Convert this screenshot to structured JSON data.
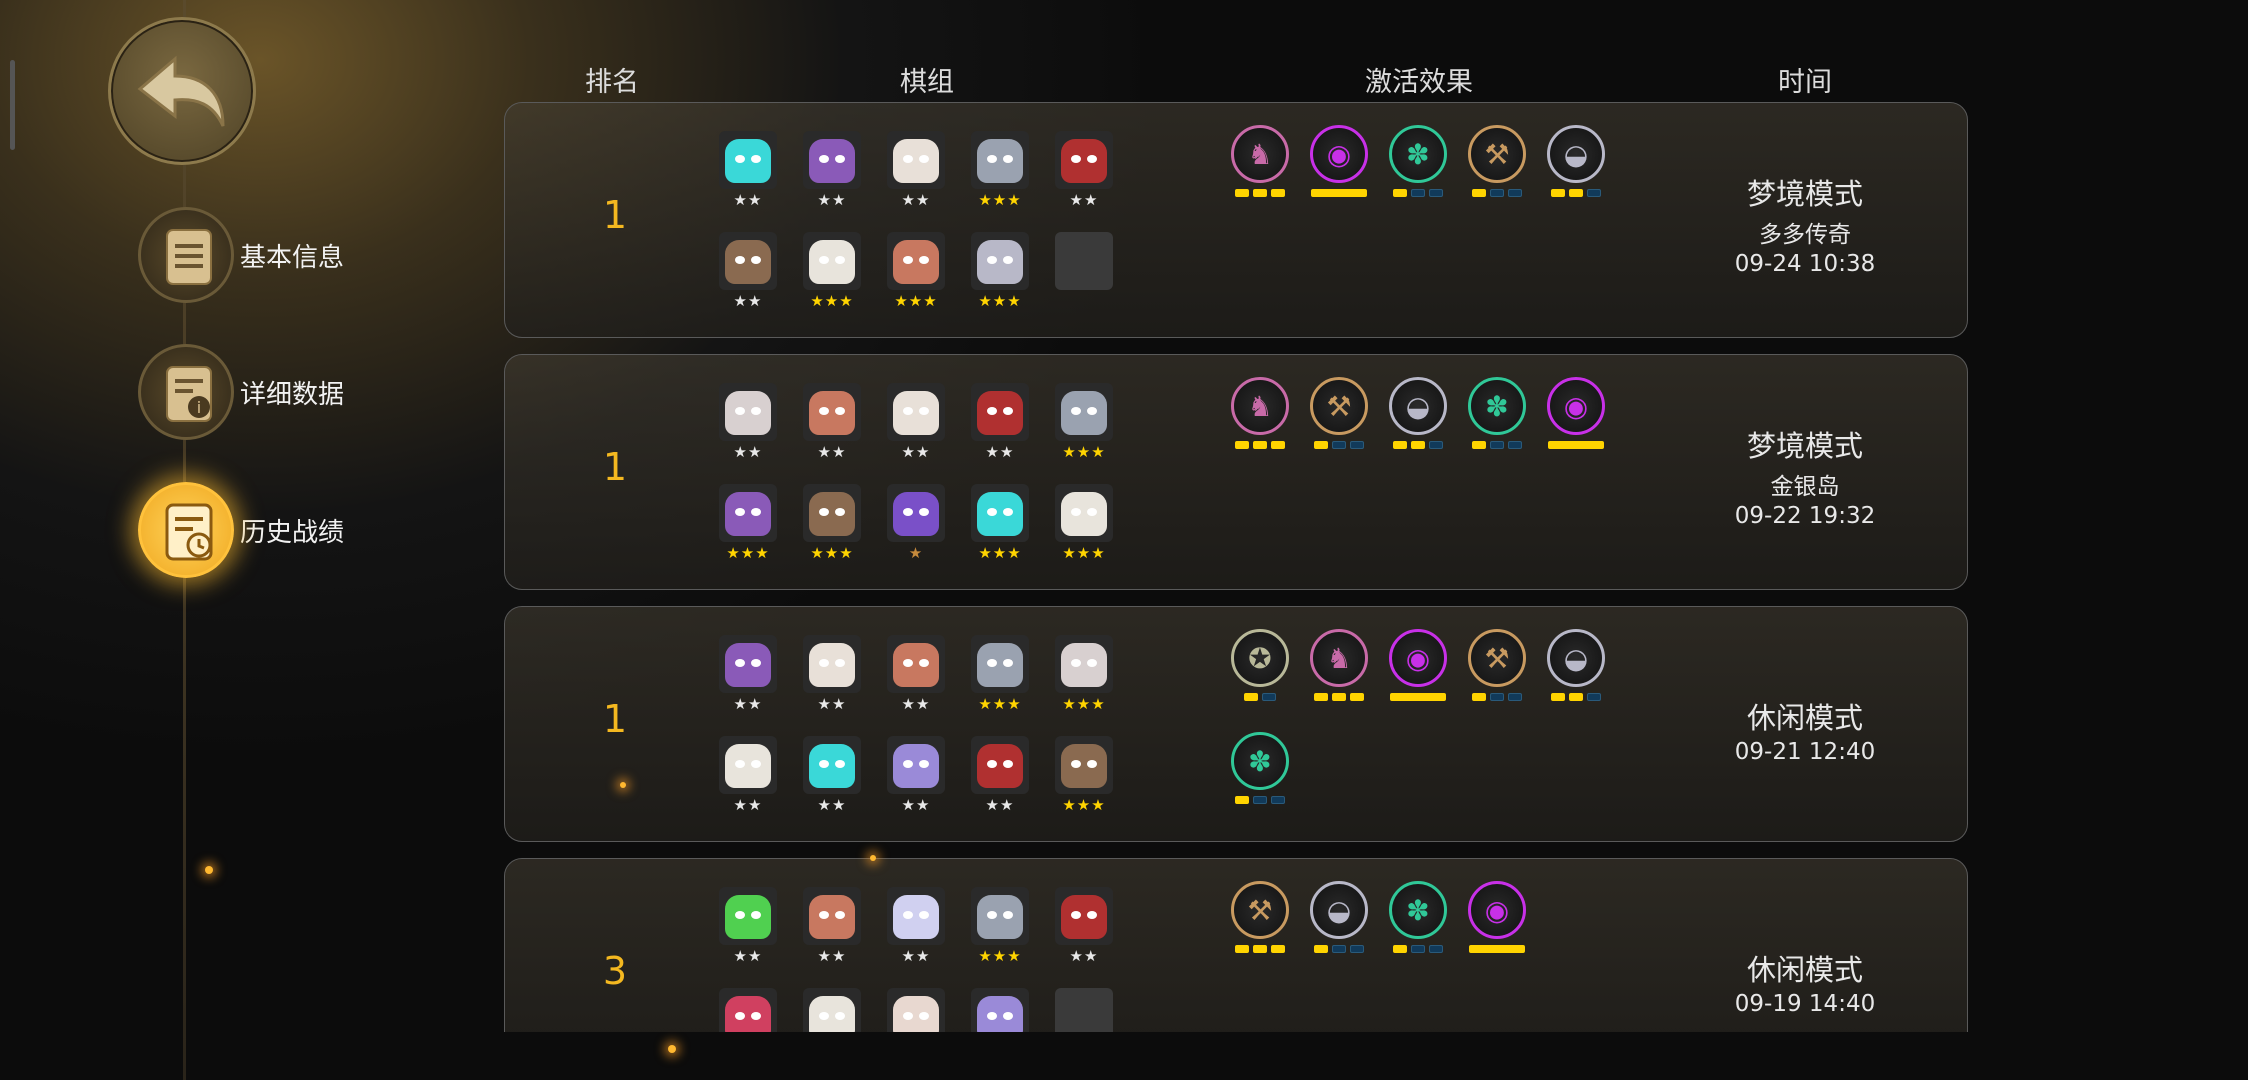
{
  "headers": {
    "rank": "排名",
    "team": "棋组",
    "effects": "激活效果",
    "time": "时间"
  },
  "nav": [
    {
      "label": "基本信息"
    },
    {
      "label": "详细数据"
    },
    {
      "label": "历史战绩"
    }
  ],
  "rows": [
    {
      "rank": "1",
      "mode": "梦境模式",
      "sub": "多多传奇",
      "time": "09-24 10:38",
      "pieces": [
        [
          "#3ad8d8",
          "★★"
        ],
        [
          "#8a5ab8",
          "★★"
        ],
        [
          "#e8e0d8",
          "★★"
        ],
        [
          "#9aa2b0",
          "★★★"
        ],
        [
          "#b03030",
          "★★"
        ],
        [
          "#8a6a50",
          "★★"
        ],
        [
          "#e8e4dc",
          "★★★"
        ],
        [
          "#c87860",
          "★★★"
        ],
        [
          "#b8b8c8",
          "★★★"
        ],
        [
          null,
          ""
        ]
      ],
      "traits": [
        [
          "#c86aa8",
          "♞",
          3,
          3,
          false
        ],
        [
          "#c830e8",
          "◉",
          1,
          1,
          true
        ],
        [
          "#30c898",
          "✽",
          1,
          3,
          false
        ],
        [
          "#c89a60",
          "⚒",
          1,
          3,
          false
        ],
        [
          "#b8b8c8",
          "◒",
          2,
          3,
          false
        ]
      ]
    },
    {
      "rank": "1",
      "mode": "梦境模式",
      "sub": "金银岛",
      "time": "09-22 19:32",
      "pieces": [
        [
          "#d8d0d0",
          "★★"
        ],
        [
          "#c87860",
          "★★"
        ],
        [
          "#e8e0d8",
          "★★"
        ],
        [
          "#b03030",
          "★★"
        ],
        [
          "#9aa2b0",
          "★★★"
        ],
        [
          "#8a5ab8",
          "★★★"
        ],
        [
          "#8a6a50",
          "★★★"
        ],
        [
          "#7a50c8",
          "★"
        ],
        [
          "#3ad8d8",
          "★★★"
        ],
        [
          "#e8e4dc",
          "★★★"
        ]
      ],
      "traits": [
        [
          "#c86aa8",
          "♞",
          3,
          3,
          false
        ],
        [
          "#c89a60",
          "⚒",
          1,
          3,
          false
        ],
        [
          "#b8b8c8",
          "◒",
          2,
          3,
          false
        ],
        [
          "#30c898",
          "✽",
          1,
          3,
          false
        ],
        [
          "#c830e8",
          "◉",
          1,
          1,
          true
        ]
      ]
    },
    {
      "rank": "1",
      "mode": "休闲模式",
      "sub": "",
      "time": "09-21 12:40",
      "pieces": [
        [
          "#8a5ab8",
          "★★"
        ],
        [
          "#e8e0d8",
          "★★"
        ],
        [
          "#c87860",
          "★★"
        ],
        [
          "#9aa2b0",
          "★★★"
        ],
        [
          "#d8d0d0",
          "★★★"
        ],
        [
          "#e8e4dc",
          "★★"
        ],
        [
          "#3ad8d8",
          "★★"
        ],
        [
          "#9a8ad8",
          "★★"
        ],
        [
          "#b03030",
          "★★"
        ],
        [
          "#8a6a50",
          "★★★"
        ]
      ],
      "traits": [
        [
          "#b8b898",
          "✪",
          1,
          2,
          false
        ],
        [
          "#c86aa8",
          "♞",
          3,
          3,
          false
        ],
        [
          "#c830e8",
          "◉",
          1,
          1,
          true
        ],
        [
          "#c89a60",
          "⚒",
          1,
          3,
          false
        ],
        [
          "#b8b8c8",
          "◒",
          2,
          3,
          false
        ],
        [
          "#30c898",
          "✽",
          1,
          3,
          false
        ]
      ]
    },
    {
      "rank": "3",
      "mode": "休闲模式",
      "sub": "",
      "time": "09-19 14:40",
      "pieces": [
        [
          "#50d050",
          "★★"
        ],
        [
          "#c87860",
          "★★"
        ],
        [
          "#d0d0f0",
          "★★"
        ],
        [
          "#9aa2b0",
          "★★★"
        ],
        [
          "#b03030",
          "★★"
        ],
        [
          "#d04060",
          ""
        ],
        [
          "#e8e4dc",
          ""
        ],
        [
          "#e8d8d0",
          ""
        ],
        [
          "#9a8ad8",
          ""
        ],
        [
          null,
          ""
        ]
      ],
      "traits": [
        [
          "#c89a60",
          "⚒",
          3,
          3,
          false
        ],
        [
          "#b8b8c8",
          "◒",
          1,
          3,
          false
        ],
        [
          "#30c898",
          "✽",
          1,
          3,
          false
        ],
        [
          "#c830e8",
          "◉",
          1,
          1,
          true
        ]
      ]
    }
  ]
}
